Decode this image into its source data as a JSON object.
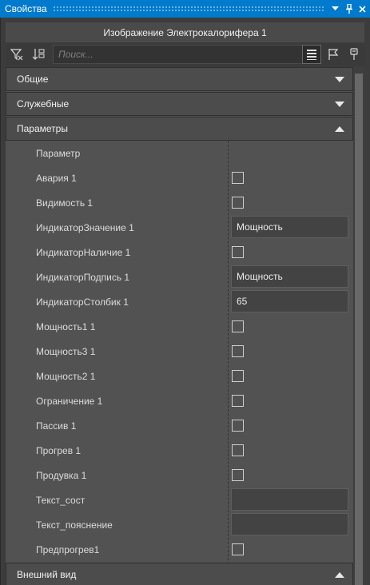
{
  "window": {
    "title": "Свойства",
    "buttons": [
      "▾",
      "🖈",
      "✕"
    ]
  },
  "header": {
    "title": "Изображение Электрокалорифера 1"
  },
  "toolbar": {
    "filter_icon": "filter-icon",
    "sort_icon": "sort-icon",
    "search_placeholder": "Поиск...",
    "view_icon": "list-view-icon",
    "flag_icon": "flag-icon",
    "pin_icon": "pin-icon"
  },
  "sections": {
    "general": "Общие",
    "service": "Служебные",
    "parameters": "Параметры",
    "appearance": "Внешний вид"
  },
  "parameters": [
    {
      "label": "Параметр",
      "type": "none",
      "value": ""
    },
    {
      "label": "Авария 1",
      "type": "checkbox",
      "value": ""
    },
    {
      "label": "Видимость 1",
      "type": "checkbox",
      "value": ""
    },
    {
      "label": "ИндикаторЗначение 1",
      "type": "text",
      "value": "Мощность"
    },
    {
      "label": "ИндикаторНаличие 1",
      "type": "checkbox",
      "value": ""
    },
    {
      "label": "ИндикаторПодпись 1",
      "type": "text",
      "value": "Мощность"
    },
    {
      "label": "ИндикаторСтолбик 1",
      "type": "text",
      "value": "65"
    },
    {
      "label": "Мощность1 1",
      "type": "checkbox",
      "value": ""
    },
    {
      "label": "Мощность3 1",
      "type": "checkbox",
      "value": ""
    },
    {
      "label": "Мощность2 1",
      "type": "checkbox",
      "value": ""
    },
    {
      "label": "Ограничение 1",
      "type": "checkbox",
      "value": ""
    },
    {
      "label": "Пассив 1",
      "type": "checkbox",
      "value": ""
    },
    {
      "label": "Прогрев 1",
      "type": "checkbox",
      "value": ""
    },
    {
      "label": "Продувка 1",
      "type": "checkbox",
      "value": ""
    },
    {
      "label": "Текст_сост",
      "type": "text",
      "value": ""
    },
    {
      "label": "Текст_пояснение",
      "type": "text",
      "value": ""
    },
    {
      "label": "Предпрогрев1",
      "type": "checkbox",
      "value": ""
    }
  ]
}
